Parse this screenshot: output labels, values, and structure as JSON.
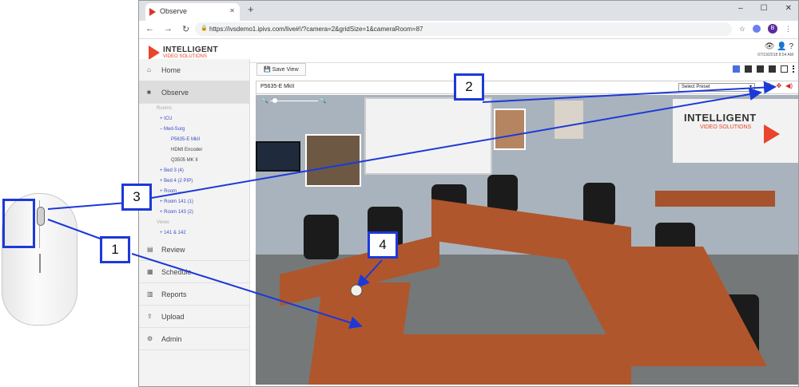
{
  "browser": {
    "tab_title": "Observe",
    "tab_close": "✕",
    "new_tab": "+",
    "url": "https://ivsdemo1.ipivs.com/live#!/?camera=2&gridSize=1&cameraRoom=87",
    "profile_initial": "B",
    "window_controls": [
      "–",
      "☐",
      "✕"
    ]
  },
  "app": {
    "logo_line1": "INTELLIGENT",
    "logo_line2": "VIDEO SOLUTIONS",
    "header_date": "07/19/2018 8:54 AM"
  },
  "sidebar": {
    "items_top": [
      {
        "icon": "home-icon",
        "label": "Home"
      },
      {
        "icon": "video-camera-icon",
        "label": "Observe"
      }
    ],
    "rooms_label": "Rooms",
    "rooms": [
      {
        "label": "ICU"
      },
      {
        "label": "Med-Surg"
      }
    ],
    "cameras": [
      {
        "label": "P5635-E MkII"
      },
      {
        "label": "HDMI Encoder"
      },
      {
        "label": "Q3505 MK II"
      }
    ],
    "rooms_more": [
      {
        "label": "Bed 3 (4)"
      },
      {
        "label": "Bed 4 (2 PIP)"
      },
      {
        "label": "Room ..."
      },
      {
        "label": "Room 141 (1)"
      },
      {
        "label": "Room 143 (2)"
      }
    ],
    "views_label": "Views",
    "views": [
      {
        "label": "141 & 142"
      }
    ],
    "items_bottom": [
      {
        "icon": "film-icon",
        "label": "Review"
      },
      {
        "icon": "calendar-icon",
        "label": "Schedule"
      },
      {
        "icon": "bar-chart-icon",
        "label": "Reports"
      },
      {
        "icon": "upload-icon",
        "label": "Upload"
      },
      {
        "icon": "gear-icon",
        "label": "Admin"
      }
    ]
  },
  "toolbar": {
    "save_view_label": "Save View"
  },
  "camera": {
    "name": "P5635-E MkII",
    "preset_placeholder": "Select Preset"
  },
  "video": {
    "banner_line1": "INTELLIGENT",
    "banner_line2": "VIDEO SOLUTIONS"
  },
  "callouts": [
    "1",
    "2",
    "3",
    "4"
  ],
  "colors": {
    "callout_blue": "#1c39d8",
    "accent": "#e8452c",
    "grid_active": "#4a6ee0",
    "ptz_red": "#c22222"
  }
}
